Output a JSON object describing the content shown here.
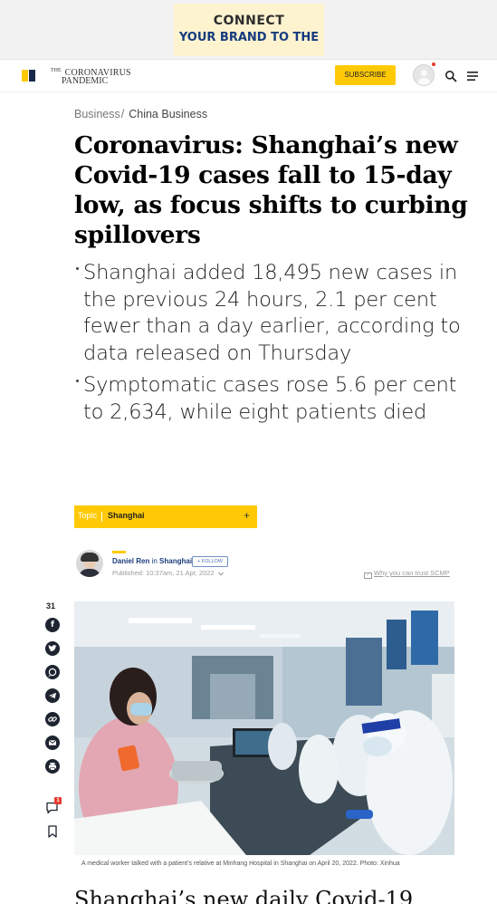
{
  "ad": {
    "line1": "CONNECT",
    "line2": "YOUR BRAND TO THE"
  },
  "header": {
    "brand_small": "THE",
    "brand_line1": "CORONAVIRUS",
    "brand_line2": "PANDEMIC",
    "subscribe_label": "SUBSCRIBE",
    "accent_color": "#ffca05",
    "brand_dark": "#1b2a4a"
  },
  "breadcrumb": {
    "parent": "Business",
    "separator": "/",
    "current": "China Business"
  },
  "article": {
    "headline": "Coronavirus: Shanghai’s new Covid-19 cases fall to 15-day low, as focus shifts to curbing spillovers",
    "summary": [
      "Shanghai added 18,495 new cases in the previous 24 hours, 2.1 per cent fewer than a day earlier, according to data released on Thursday",
      "Symptomatic cases rose 5.6 per cent to 2,634, while eight patients died"
    ],
    "topic": {
      "label": "Topic",
      "value": "Shanghai",
      "plus": "+"
    },
    "author": {
      "name": "Daniel Ren",
      "in": "in",
      "location": "Shanghai",
      "follow_label": "+ FOLLOW",
      "published": "Published: 10:37am, 21 Apr, 2022"
    },
    "trust_label": "Why you can trust SCMP",
    "share_count": "31",
    "comments_badge": "1",
    "photo_caption": "A medical worker talked with a patient’s relative at Minhang Hospital in Shanghai on April 20, 2022. Photo: Xinhua",
    "next_heading": "Shanghai’s new daily Covid-19"
  }
}
